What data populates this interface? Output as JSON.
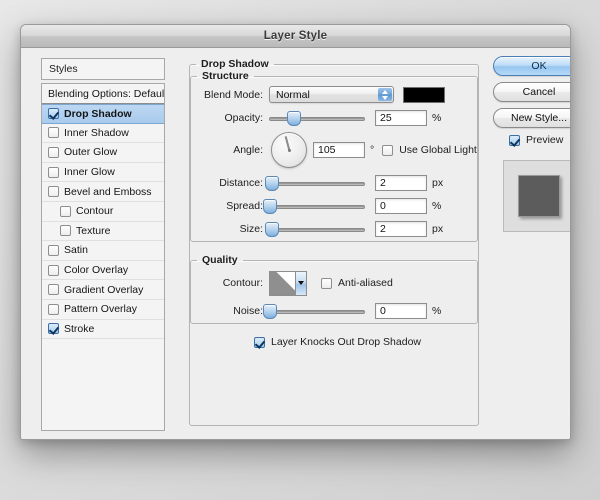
{
  "window": {
    "title": "Layer Style"
  },
  "styles_panel": {
    "header": "Styles",
    "items": [
      {
        "label": "Blending Options: Default",
        "checked": null,
        "sub": false,
        "selected": false
      },
      {
        "label": "Drop Shadow",
        "checked": true,
        "sub": false,
        "selected": true
      },
      {
        "label": "Inner Shadow",
        "checked": false,
        "sub": false,
        "selected": false
      },
      {
        "label": "Outer Glow",
        "checked": false,
        "sub": false,
        "selected": false
      },
      {
        "label": "Inner Glow",
        "checked": false,
        "sub": false,
        "selected": false
      },
      {
        "label": "Bevel and Emboss",
        "checked": false,
        "sub": false,
        "selected": false
      },
      {
        "label": "Contour",
        "checked": false,
        "sub": true,
        "selected": false
      },
      {
        "label": "Texture",
        "checked": false,
        "sub": true,
        "selected": false
      },
      {
        "label": "Satin",
        "checked": false,
        "sub": false,
        "selected": false
      },
      {
        "label": "Color Overlay",
        "checked": false,
        "sub": false,
        "selected": false
      },
      {
        "label": "Gradient Overlay",
        "checked": false,
        "sub": false,
        "selected": false
      },
      {
        "label": "Pattern Overlay",
        "checked": false,
        "sub": false,
        "selected": false
      },
      {
        "label": "Stroke",
        "checked": true,
        "sub": false,
        "selected": false
      }
    ]
  },
  "main": {
    "section_title": "Drop Shadow",
    "structure": {
      "legend": "Structure",
      "blend_mode": {
        "label": "Blend Mode:",
        "value": "Normal",
        "color": "#000000"
      },
      "opacity": {
        "label": "Opacity:",
        "value": "25",
        "unit": "%",
        "percent": 25
      },
      "angle": {
        "label": "Angle:",
        "value": "105",
        "unit": "°",
        "degrees": 105,
        "global_light_label": "Use Global Light",
        "global_light_checked": false
      },
      "distance": {
        "label": "Distance:",
        "value": "2",
        "unit": "px",
        "percent": 2
      },
      "spread": {
        "label": "Spread:",
        "value": "0",
        "unit": "%",
        "percent": 0
      },
      "size": {
        "label": "Size:",
        "value": "2",
        "unit": "px",
        "percent": 2
      }
    },
    "quality": {
      "legend": "Quality",
      "contour": {
        "label": "Contour:",
        "anti_aliased_label": "Anti-aliased",
        "anti_aliased_checked": false
      },
      "noise": {
        "label": "Noise:",
        "value": "0",
        "unit": "%",
        "percent": 0
      }
    },
    "knockout": {
      "label": "Layer Knocks Out Drop Shadow",
      "checked": true
    }
  },
  "buttons": {
    "ok": "OK",
    "cancel": "Cancel",
    "new_style": "New Style...",
    "preview": {
      "label": "Preview",
      "checked": true
    }
  },
  "colors": {
    "selection_blue": "#a9cbee",
    "accent_blue": "#6ea4d8",
    "shadow_color": "#000000",
    "preview_square": "#5c5c5c"
  }
}
